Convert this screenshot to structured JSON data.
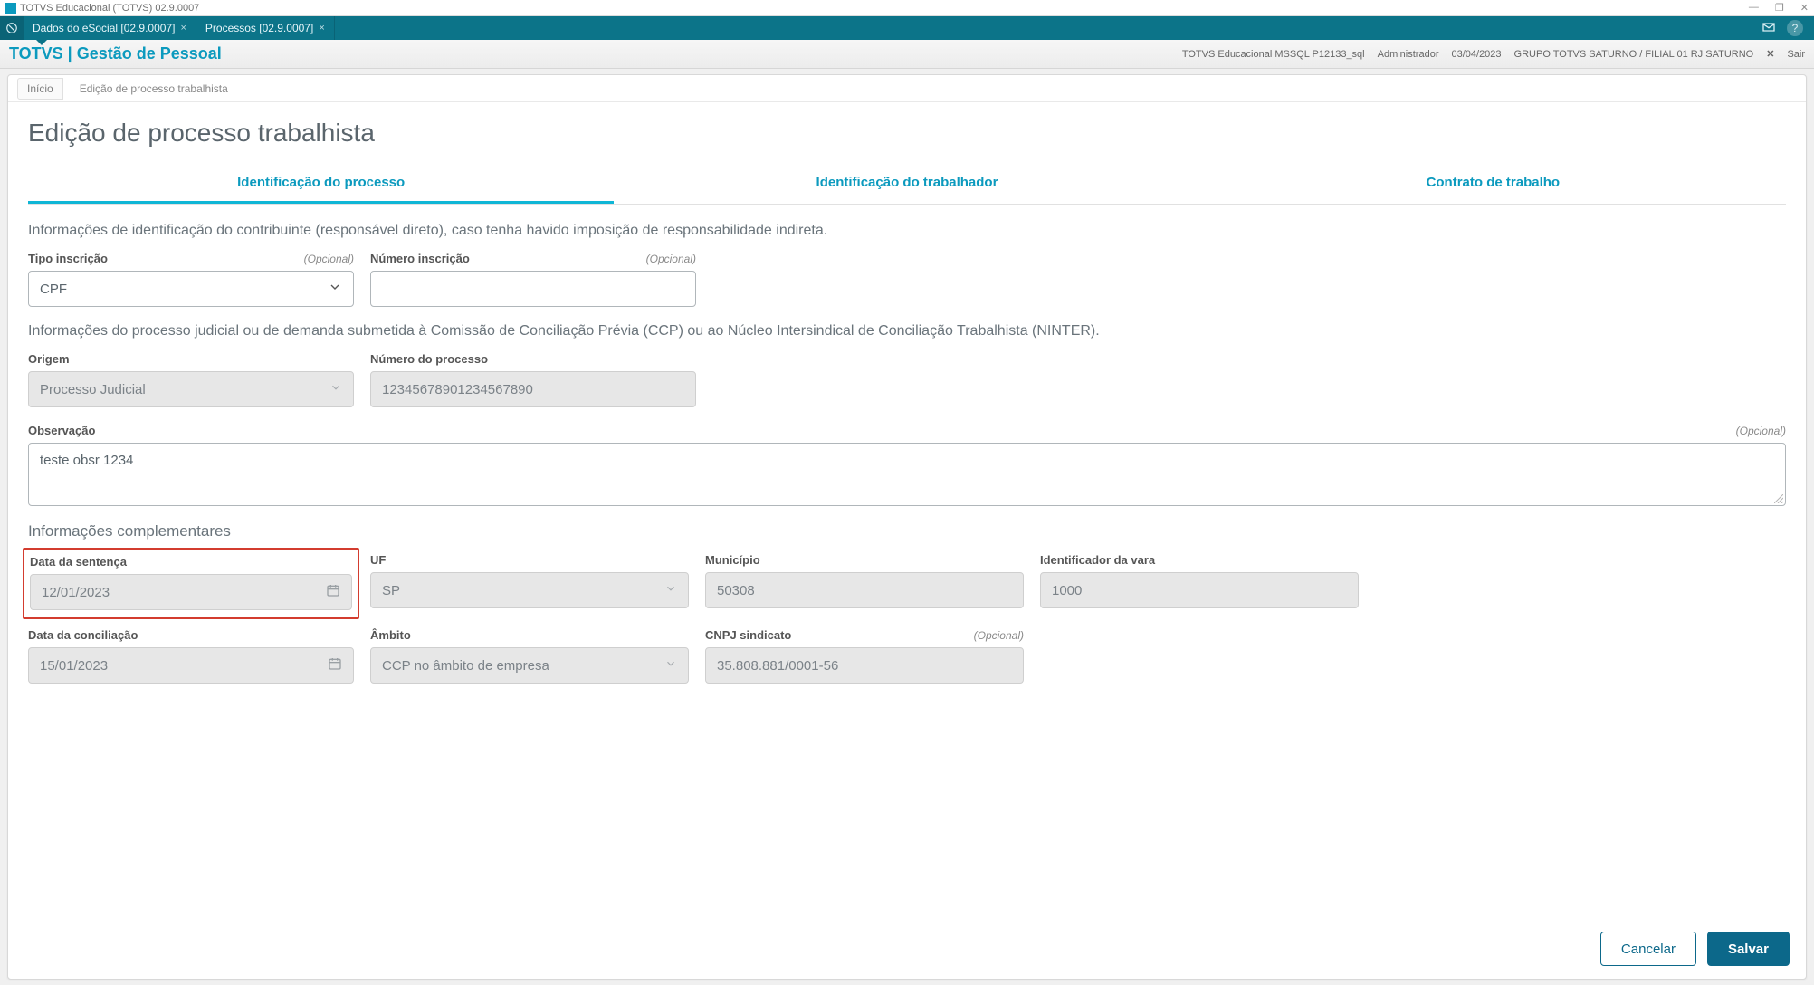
{
  "window": {
    "title": "TOTVS Educacional (TOTVS) 02.9.0007",
    "controls": {
      "minimize": "—",
      "maximize": "❐",
      "close": "✕"
    }
  },
  "tabbar": {
    "tabs": [
      {
        "label": "Dados do eSocial [02.9.0007]",
        "active": true
      },
      {
        "label": "Processos [02.9.0007]",
        "active": false
      }
    ],
    "icons": {
      "mail": "mail-icon",
      "help": "?"
    }
  },
  "header": {
    "brand": "TOTVS | Gestão de Pessoal",
    "env": "TOTVS Educacional MSSQL P12133_sql",
    "user": "Administrador",
    "date": "03/04/2023",
    "company": "GRUPO TOTVS SATURNO / FILIAL 01 RJ SATURNO",
    "logout_x": "✕",
    "logout_label": "Sair"
  },
  "breadcrumb": {
    "items": [
      "Início",
      "Edição de processo trabalhista"
    ]
  },
  "page": {
    "title": "Edição de processo trabalhista",
    "tabs": [
      {
        "label": "Identificação do processo",
        "active": true
      },
      {
        "label": "Identificação do trabalhador",
        "active": false
      },
      {
        "label": "Contrato de trabalho",
        "active": false
      }
    ],
    "section1_text": "Informações de identificação do contribuinte (responsável direto), caso tenha havido imposição de responsabilidade indireta.",
    "optional_text": "(Opcional)",
    "fields": {
      "tipo_inscricao": {
        "label": "Tipo inscrição",
        "value": "CPF"
      },
      "numero_inscricao": {
        "label": "Número inscrição",
        "value": ""
      }
    },
    "section2_text": "Informações do processo judicial ou de demanda submetida à Comissão de Conciliação Prévia (CCP) ou ao Núcleo Intersindical de Conciliação Trabalhista (NINTER).",
    "fields2": {
      "origem": {
        "label": "Origem",
        "value": "Processo Judicial"
      },
      "numero_processo": {
        "label": "Número do processo",
        "value": "12345678901234567890"
      },
      "observacao": {
        "label": "Observação",
        "value": "teste obsr 1234"
      }
    },
    "section3_title": "Informações complementares",
    "fields3": {
      "data_sentenca": {
        "label": "Data da sentença",
        "value": "12/01/2023"
      },
      "uf": {
        "label": "UF",
        "value": "SP"
      },
      "municipio": {
        "label": "Município",
        "value": "50308"
      },
      "id_vara": {
        "label": "Identificador da vara",
        "value": "1000"
      },
      "data_conciliacao": {
        "label": "Data da conciliação",
        "value": "15/01/2023"
      },
      "ambito": {
        "label": "Âmbito",
        "value": "CCP no âmbito de empresa"
      },
      "cnpj_sindicato": {
        "label": "CNPJ sindicato",
        "value": "35.808.881/0001-56"
      }
    },
    "buttons": {
      "cancel": "Cancelar",
      "save": "Salvar"
    }
  }
}
